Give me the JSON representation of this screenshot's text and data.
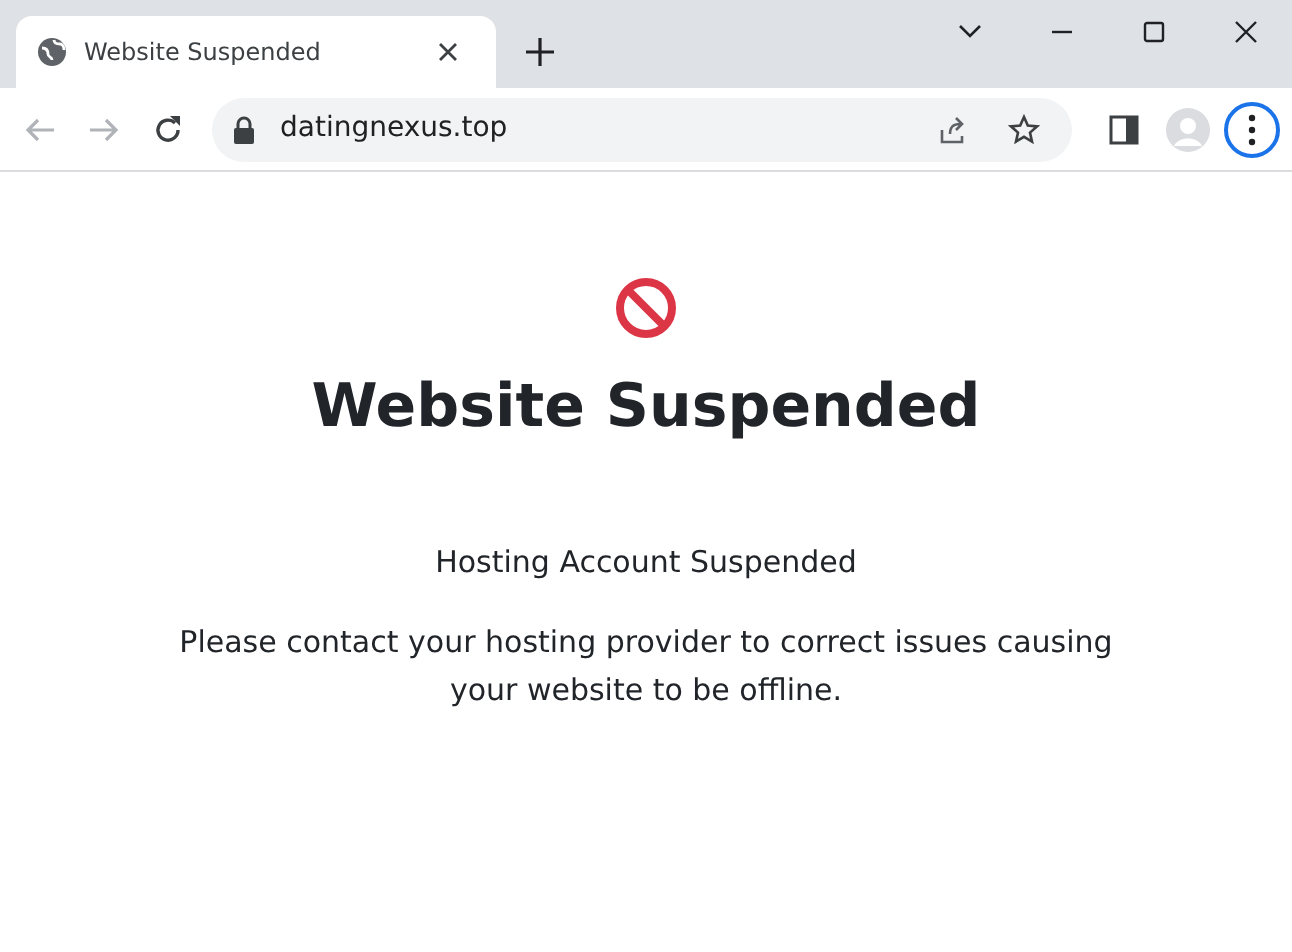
{
  "tabs": [
    {
      "title": "Website Suspended",
      "selected": true
    }
  ],
  "toolbar": {
    "back": {
      "disabled": true
    },
    "forward": {
      "disabled": true
    },
    "address": "datingnexus.top"
  },
  "page": {
    "heading": "Website Suspended",
    "subheading": "Hosting Account Suspended",
    "message": "Please contact your hosting provider to correct issues causing your website to be offline."
  }
}
